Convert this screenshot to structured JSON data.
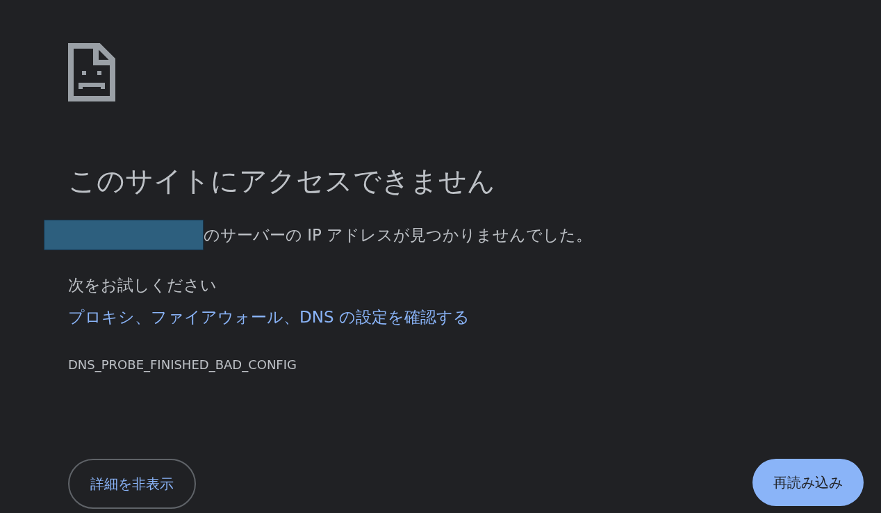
{
  "heading": "このサイトにアクセスできません",
  "message": {
    "redacted": true,
    "text": "のサーバーの IP アドレスが見つかりませんでした。"
  },
  "suggestions_title": "次をお試しください",
  "suggestions": [
    "プロキシ、ファイアウォール、DNS の設定を確認する"
  ],
  "error_code": "DNS_PROBE_FINISHED_BAD_CONFIG",
  "buttons": [
    {
      "label": "詳細を非表示",
      "kind": "secondary"
    },
    {
      "label": "再読み込み",
      "kind": "primary"
    }
  ]
}
